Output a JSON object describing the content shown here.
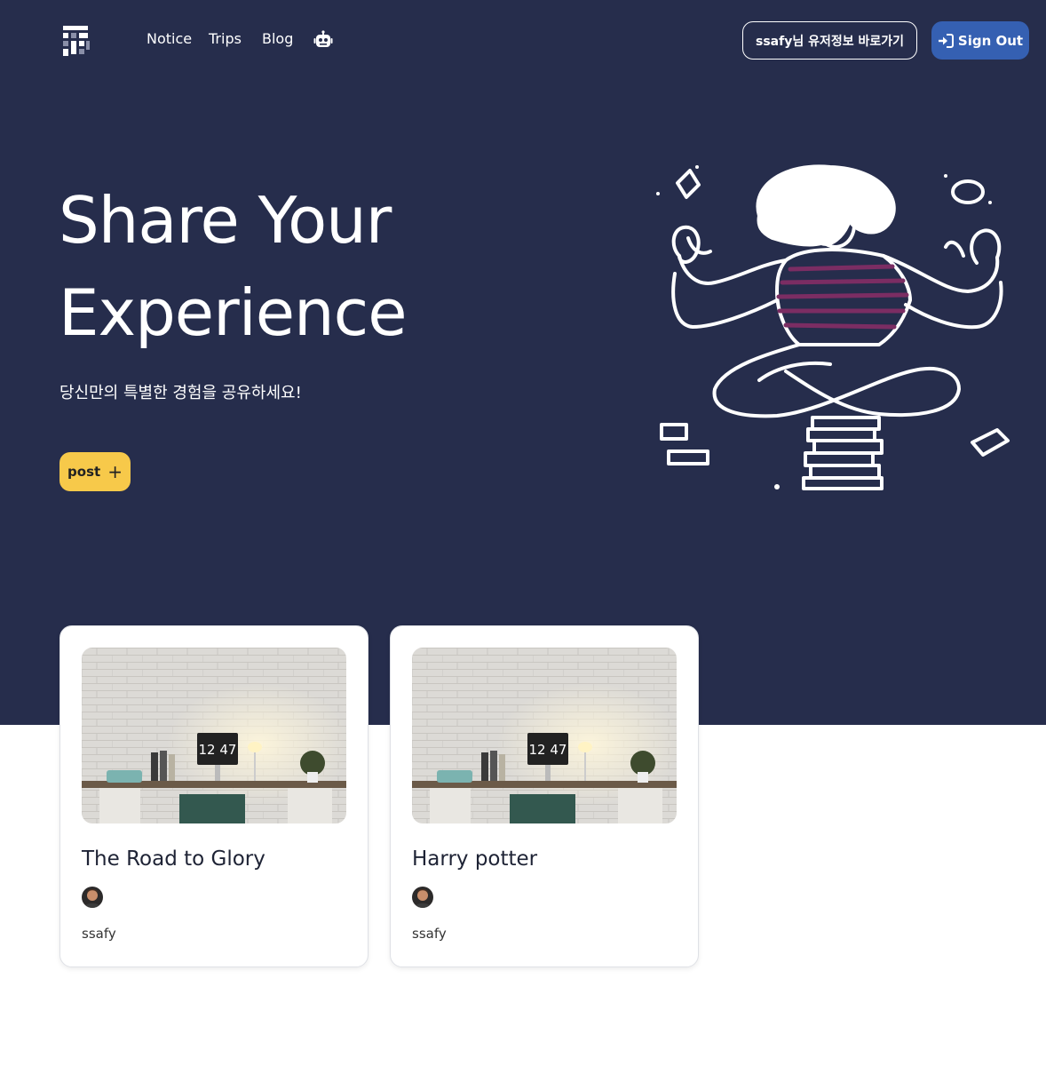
{
  "nav": {
    "links": [
      "Notice",
      "Trips",
      "Blog"
    ],
    "bot_icon": "robot-icon",
    "profile_button": "ssafy님 유저정보 바로가기",
    "signout_button": "Sign Out",
    "signout_icon": "sign-in-arrow-icon"
  },
  "hero": {
    "title_line1": "Share Your",
    "title_line2": "Experience",
    "subtitle": "당신만의 특별한 경험을 공유하세요!",
    "post_button": "post",
    "post_icon": "plus-icon"
  },
  "cards": [
    {
      "title": "The Road to Glory",
      "author": "ssafy",
      "thumb_clock": "12 47"
    },
    {
      "title": "Harry potter",
      "author": "ssafy",
      "thumb_clock": "12 47"
    }
  ],
  "colors": {
    "hero_bg": "#262d4c",
    "signout_bg": "#3560b2",
    "post_bg": "#f7c94a",
    "stripe_accent": "#7b2d63"
  }
}
